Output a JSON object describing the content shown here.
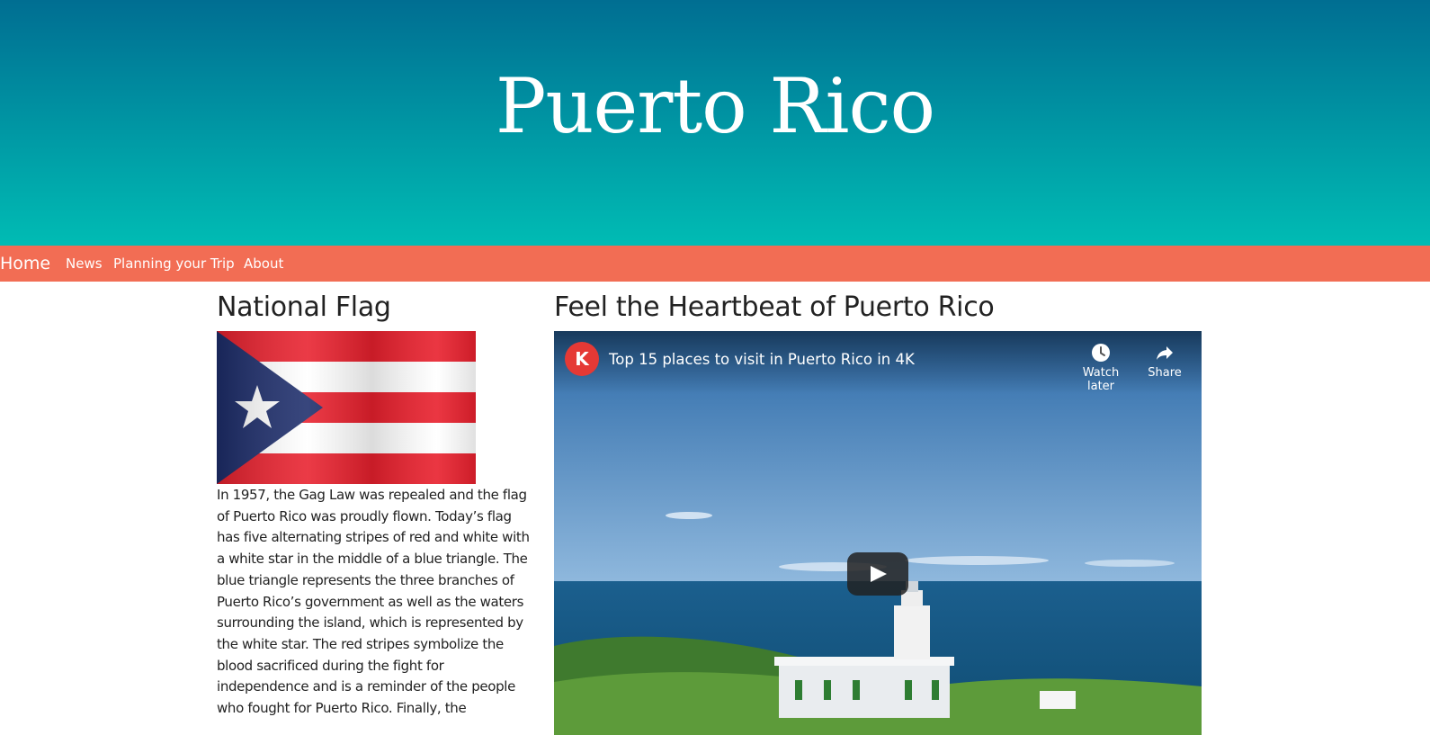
{
  "header": {
    "title": "Puerto Rico"
  },
  "nav": {
    "items": [
      {
        "label": "Home"
      },
      {
        "label": "News"
      },
      {
        "label": "Planning your Trip"
      },
      {
        "label": "About"
      }
    ]
  },
  "flag_section": {
    "heading": "National Flag",
    "image_alt": "Puerto Rico flag",
    "text": "In 1957, the Gag Law was repealed and the flag of Puerto Rico was proudly flown. Today’s flag has five alternating stripes of red and white with a white star in the middle of a blue triangle. The blue triangle represents the three branches of Puerto Rico’s government as well as the waters surrounding the island, which is represented by the white star. The red stripes symbolize the blood sacrificed during the fight for independence and is a reminder of the people who fought for Puerto Rico. Finally, the"
  },
  "video_section": {
    "heading": "Feel the Heartbeat of Puerto Rico",
    "video": {
      "channel_logo": "K",
      "title": "Top 15 places to visit in Puerto Rico in 4K",
      "watch_later_label": "Watch later",
      "share_label": "Share",
      "icons": {
        "watch_later": "clock-icon",
        "share": "share-arrow-icon",
        "play": "play-icon"
      }
    }
  },
  "colors": {
    "header_top": "#006e92",
    "header_bottom": "#00bcb4",
    "nav_background": "#f26d54",
    "flag_red": "#e8202d",
    "flag_blue": "#1d2d6b"
  }
}
